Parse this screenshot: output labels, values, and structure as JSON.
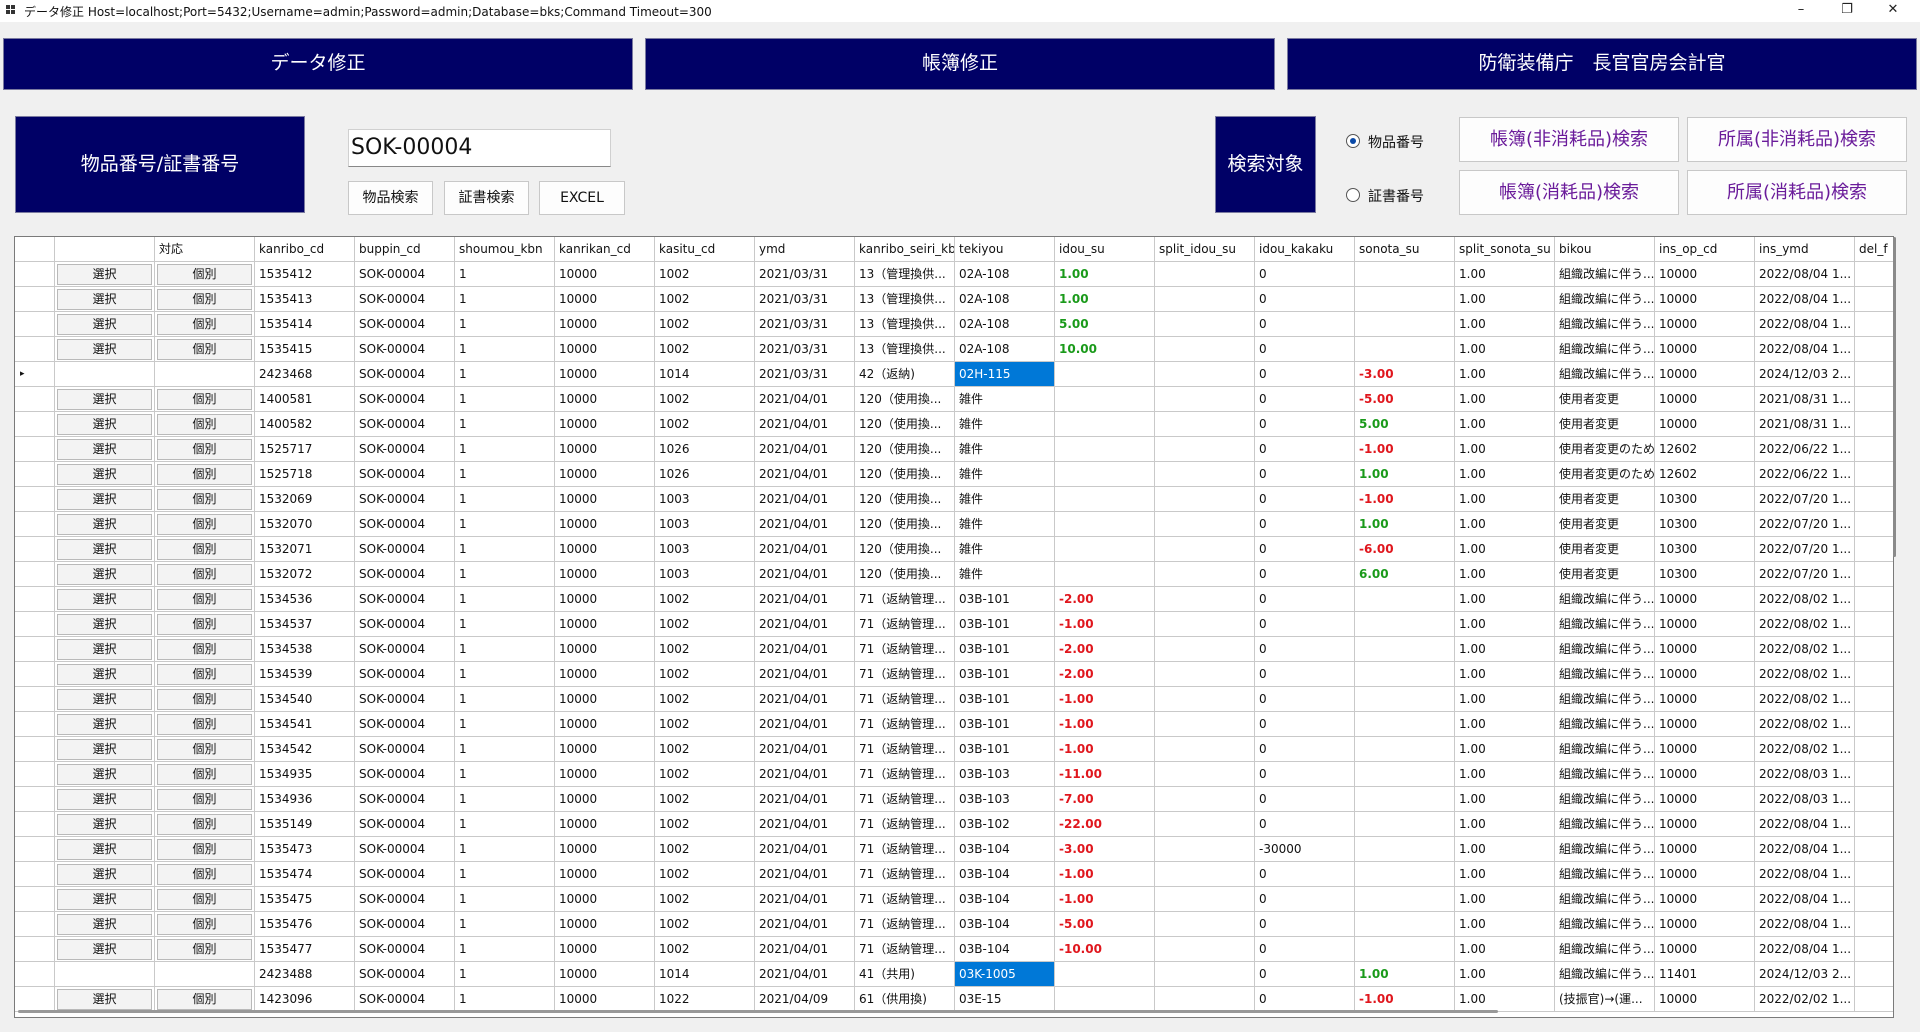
{
  "window": {
    "title": "データ修正 Host=localhost;Port=5432;Username=admin;Password=admin;Database=bks;Command Timeout=300",
    "minimize": "–",
    "maximize": "❐",
    "close": "✕"
  },
  "nav": {
    "data_edit": "データ修正",
    "ledger_edit": "帳簿修正",
    "org": "防衛装備庁　長官官房会計官"
  },
  "search": {
    "label": "物品番号/証書番号",
    "value": "SOK-00004",
    "btn_item": "物品検索",
    "btn_cert": "証書検索",
    "btn_excel": "EXCEL",
    "target_label": "検索対象",
    "radio_item": "物品番号",
    "radio_cert": "証書番号",
    "radio_selected": "物品番号",
    "btn_ledger_nonconsumable": "帳簿(非消耗品)検索",
    "btn_belong_nonconsumable": "所属(非消耗品)検索",
    "btn_ledger_consumable": "帳簿(消耗品)検索",
    "btn_belong_consumable": "所属(消耗品)検索"
  },
  "grid": {
    "columns": [
      "",
      "",
      "対応",
      "kanribo_cd",
      "buppin_cd",
      "shoumou_kbn",
      "kanrikan_cd",
      "kasitu_cd",
      "ymd",
      "kanribo_seiri_kbn",
      "tekiyou",
      "idou_su",
      "split_idou_su",
      "idou_kakaku",
      "sonota_su",
      "split_sonota_su",
      "bikou",
      "ins_op_cd",
      "ins_ymd",
      "del_f"
    ],
    "rows": [
      {
        "marker": "",
        "sel": "選択",
        "taiou": "個別",
        "kanribo_cd": "1535412",
        "buppin_cd": "SOK-00004",
        "shoumou": "1",
        "kanrikan": "10000",
        "kasitu": "1002",
        "ymd": "2021/03/31",
        "seiri": "13（管理換供...",
        "tekiyou": "02A-108",
        "idou": "1.00",
        "split_idou": "",
        "kakaku": "0",
        "sonota": "",
        "split_sonota": "1.00",
        "bikou": "組織改編に伴う...",
        "ins_op": "10000",
        "ins_ymd": "2022/08/04 1..."
      },
      {
        "marker": "",
        "sel": "選択",
        "taiou": "個別",
        "kanribo_cd": "1535413",
        "buppin_cd": "SOK-00004",
        "shoumou": "1",
        "kanrikan": "10000",
        "kasitu": "1002",
        "ymd": "2021/03/31",
        "seiri": "13（管理換供...",
        "tekiyou": "02A-108",
        "idou": "1.00",
        "split_idou": "",
        "kakaku": "0",
        "sonota": "",
        "split_sonota": "1.00",
        "bikou": "組織改編に伴う...",
        "ins_op": "10000",
        "ins_ymd": "2022/08/04 1..."
      },
      {
        "marker": "",
        "sel": "選択",
        "taiou": "個別",
        "kanribo_cd": "1535414",
        "buppin_cd": "SOK-00004",
        "shoumou": "1",
        "kanrikan": "10000",
        "kasitu": "1002",
        "ymd": "2021/03/31",
        "seiri": "13（管理換供...",
        "tekiyou": "02A-108",
        "idou": "5.00",
        "split_idou": "",
        "kakaku": "0",
        "sonota": "",
        "split_sonota": "1.00",
        "bikou": "組織改編に伴う...",
        "ins_op": "10000",
        "ins_ymd": "2022/08/04 1..."
      },
      {
        "marker": "",
        "sel": "選択",
        "taiou": "個別",
        "kanribo_cd": "1535415",
        "buppin_cd": "SOK-00004",
        "shoumou": "1",
        "kanrikan": "10000",
        "kasitu": "1002",
        "ymd": "2021/03/31",
        "seiri": "13（管理換供...",
        "tekiyou": "02A-108",
        "idou": "10.00",
        "split_idou": "",
        "kakaku": "0",
        "sonota": "",
        "split_sonota": "1.00",
        "bikou": "組織改編に伴う...",
        "ins_op": "10000",
        "ins_ymd": "2022/08/04 1..."
      },
      {
        "marker": "▸",
        "sel": "",
        "taiou": "",
        "kanribo_cd": "2423468",
        "buppin_cd": "SOK-00004",
        "shoumou": "1",
        "kanrikan": "10000",
        "kasitu": "1014",
        "ymd": "2021/03/31",
        "seiri": "42（返納)",
        "tekiyou": "02H-115",
        "tekiyou_selected": true,
        "idou": "",
        "split_idou": "",
        "kakaku": "0",
        "sonota": "-3.00",
        "split_sonota": "1.00",
        "bikou": "組織改編に伴う...",
        "ins_op": "10000",
        "ins_ymd": "2024/12/03 2..."
      },
      {
        "marker": "",
        "sel": "選択",
        "taiou": "個別",
        "kanribo_cd": "1400581",
        "buppin_cd": "SOK-00004",
        "shoumou": "1",
        "kanrikan": "10000",
        "kasitu": "1002",
        "ymd": "2021/04/01",
        "seiri": "120（使用換...",
        "tekiyou": "雑件",
        "idou": "",
        "split_idou": "",
        "kakaku": "0",
        "sonota": "-5.00",
        "split_sonota": "1.00",
        "bikou": "使用者変更",
        "ins_op": "10000",
        "ins_ymd": "2021/08/31 1..."
      },
      {
        "marker": "",
        "sel": "選択",
        "taiou": "個別",
        "kanribo_cd": "1400582",
        "buppin_cd": "SOK-00004",
        "shoumou": "1",
        "kanrikan": "10000",
        "kasitu": "1002",
        "ymd": "2021/04/01",
        "seiri": "120（使用換...",
        "tekiyou": "雑件",
        "idou": "",
        "split_idou": "",
        "kakaku": "0",
        "sonota": "5.00",
        "split_sonota": "1.00",
        "bikou": "使用者変更",
        "ins_op": "10000",
        "ins_ymd": "2021/08/31 1..."
      },
      {
        "marker": "",
        "sel": "選択",
        "taiou": "個別",
        "kanribo_cd": "1525717",
        "buppin_cd": "SOK-00004",
        "shoumou": "1",
        "kanrikan": "10000",
        "kasitu": "1026",
        "ymd": "2021/04/01",
        "seiri": "120（使用換...",
        "tekiyou": "雑件",
        "idou": "",
        "split_idou": "",
        "kakaku": "0",
        "sonota": "-1.00",
        "split_sonota": "1.00",
        "bikou": "使用者変更のため",
        "ins_op": "12602",
        "ins_ymd": "2022/06/22 1..."
      },
      {
        "marker": "",
        "sel": "選択",
        "taiou": "個別",
        "kanribo_cd": "1525718",
        "buppin_cd": "SOK-00004",
        "shoumou": "1",
        "kanrikan": "10000",
        "kasitu": "1026",
        "ymd": "2021/04/01",
        "seiri": "120（使用換...",
        "tekiyou": "雑件",
        "idou": "",
        "split_idou": "",
        "kakaku": "0",
        "sonota": "1.00",
        "split_sonota": "1.00",
        "bikou": "使用者変更のため",
        "ins_op": "12602",
        "ins_ymd": "2022/06/22 1..."
      },
      {
        "marker": "",
        "sel": "選択",
        "taiou": "個別",
        "kanribo_cd": "1532069",
        "buppin_cd": "SOK-00004",
        "shoumou": "1",
        "kanrikan": "10000",
        "kasitu": "1003",
        "ymd": "2021/04/01",
        "seiri": "120（使用換...",
        "tekiyou": "雑件",
        "idou": "",
        "split_idou": "",
        "kakaku": "0",
        "sonota": "-1.00",
        "split_sonota": "1.00",
        "bikou": "使用者変更",
        "ins_op": "10300",
        "ins_ymd": "2022/07/20 1..."
      },
      {
        "marker": "",
        "sel": "選択",
        "taiou": "個別",
        "kanribo_cd": "1532070",
        "buppin_cd": "SOK-00004",
        "shoumou": "1",
        "kanrikan": "10000",
        "kasitu": "1003",
        "ymd": "2021/04/01",
        "seiri": "120（使用換...",
        "tekiyou": "雑件",
        "idou": "",
        "split_idou": "",
        "kakaku": "0",
        "sonota": "1.00",
        "split_sonota": "1.00",
        "bikou": "使用者変更",
        "ins_op": "10300",
        "ins_ymd": "2022/07/20 1..."
      },
      {
        "marker": "",
        "sel": "選択",
        "taiou": "個別",
        "kanribo_cd": "1532071",
        "buppin_cd": "SOK-00004",
        "shoumou": "1",
        "kanrikan": "10000",
        "kasitu": "1003",
        "ymd": "2021/04/01",
        "seiri": "120（使用換...",
        "tekiyou": "雑件",
        "idou": "",
        "split_idou": "",
        "kakaku": "0",
        "sonota": "-6.00",
        "split_sonota": "1.00",
        "bikou": "使用者変更",
        "ins_op": "10300",
        "ins_ymd": "2022/07/20 1..."
      },
      {
        "marker": "",
        "sel": "選択",
        "taiou": "個別",
        "kanribo_cd": "1532072",
        "buppin_cd": "SOK-00004",
        "shoumou": "1",
        "kanrikan": "10000",
        "kasitu": "1003",
        "ymd": "2021/04/01",
        "seiri": "120（使用換...",
        "tekiyou": "雑件",
        "idou": "",
        "split_idou": "",
        "kakaku": "0",
        "sonota": "6.00",
        "split_sonota": "1.00",
        "bikou": "使用者変更",
        "ins_op": "10300",
        "ins_ymd": "2022/07/20 1..."
      },
      {
        "marker": "",
        "sel": "選択",
        "taiou": "個別",
        "kanribo_cd": "1534536",
        "buppin_cd": "SOK-00004",
        "shoumou": "1",
        "kanrikan": "10000",
        "kasitu": "1002",
        "ymd": "2021/04/01",
        "seiri": "71（返納管理...",
        "tekiyou": "03B-101",
        "idou": "-2.00",
        "split_idou": "",
        "kakaku": "0",
        "sonota": "",
        "split_sonota": "1.00",
        "bikou": "組織改編に伴う...",
        "ins_op": "10000",
        "ins_ymd": "2022/08/02 1..."
      },
      {
        "marker": "",
        "sel": "選択",
        "taiou": "個別",
        "kanribo_cd": "1534537",
        "buppin_cd": "SOK-00004",
        "shoumou": "1",
        "kanrikan": "10000",
        "kasitu": "1002",
        "ymd": "2021/04/01",
        "seiri": "71（返納管理...",
        "tekiyou": "03B-101",
        "idou": "-1.00",
        "split_idou": "",
        "kakaku": "0",
        "sonota": "",
        "split_sonota": "1.00",
        "bikou": "組織改編に伴う...",
        "ins_op": "10000",
        "ins_ymd": "2022/08/02 1..."
      },
      {
        "marker": "",
        "sel": "選択",
        "taiou": "個別",
        "kanribo_cd": "1534538",
        "buppin_cd": "SOK-00004",
        "shoumou": "1",
        "kanrikan": "10000",
        "kasitu": "1002",
        "ymd": "2021/04/01",
        "seiri": "71（返納管理...",
        "tekiyou": "03B-101",
        "idou": "-2.00",
        "split_idou": "",
        "kakaku": "0",
        "sonota": "",
        "split_sonota": "1.00",
        "bikou": "組織改編に伴う...",
        "ins_op": "10000",
        "ins_ymd": "2022/08/02 1..."
      },
      {
        "marker": "",
        "sel": "選択",
        "taiou": "個別",
        "kanribo_cd": "1534539",
        "buppin_cd": "SOK-00004",
        "shoumou": "1",
        "kanrikan": "10000",
        "kasitu": "1002",
        "ymd": "2021/04/01",
        "seiri": "71（返納管理...",
        "tekiyou": "03B-101",
        "idou": "-2.00",
        "split_idou": "",
        "kakaku": "0",
        "sonota": "",
        "split_sonota": "1.00",
        "bikou": "組織改編に伴う...",
        "ins_op": "10000",
        "ins_ymd": "2022/08/02 1..."
      },
      {
        "marker": "",
        "sel": "選択",
        "taiou": "個別",
        "kanribo_cd": "1534540",
        "buppin_cd": "SOK-00004",
        "shoumou": "1",
        "kanrikan": "10000",
        "kasitu": "1002",
        "ymd": "2021/04/01",
        "seiri": "71（返納管理...",
        "tekiyou": "03B-101",
        "idou": "-1.00",
        "split_idou": "",
        "kakaku": "0",
        "sonota": "",
        "split_sonota": "1.00",
        "bikou": "組織改編に伴う...",
        "ins_op": "10000",
        "ins_ymd": "2022/08/02 1..."
      },
      {
        "marker": "",
        "sel": "選択",
        "taiou": "個別",
        "kanribo_cd": "1534541",
        "buppin_cd": "SOK-00004",
        "shoumou": "1",
        "kanrikan": "10000",
        "kasitu": "1002",
        "ymd": "2021/04/01",
        "seiri": "71（返納管理...",
        "tekiyou": "03B-101",
        "idou": "-1.00",
        "split_idou": "",
        "kakaku": "0",
        "sonota": "",
        "split_sonota": "1.00",
        "bikou": "組織改編に伴う...",
        "ins_op": "10000",
        "ins_ymd": "2022/08/02 1..."
      },
      {
        "marker": "",
        "sel": "選択",
        "taiou": "個別",
        "kanribo_cd": "1534542",
        "buppin_cd": "SOK-00004",
        "shoumou": "1",
        "kanrikan": "10000",
        "kasitu": "1002",
        "ymd": "2021/04/01",
        "seiri": "71（返納管理...",
        "tekiyou": "03B-101",
        "idou": "-1.00",
        "split_idou": "",
        "kakaku": "0",
        "sonota": "",
        "split_sonota": "1.00",
        "bikou": "組織改編に伴う...",
        "ins_op": "10000",
        "ins_ymd": "2022/08/02 1..."
      },
      {
        "marker": "",
        "sel": "選択",
        "taiou": "個別",
        "kanribo_cd": "1534935",
        "buppin_cd": "SOK-00004",
        "shoumou": "1",
        "kanrikan": "10000",
        "kasitu": "1002",
        "ymd": "2021/04/01",
        "seiri": "71（返納管理...",
        "tekiyou": "03B-103",
        "idou": "-11.00",
        "split_idou": "",
        "kakaku": "0",
        "sonota": "",
        "split_sonota": "1.00",
        "bikou": "組織改編に伴う...",
        "ins_op": "10000",
        "ins_ymd": "2022/08/03 1..."
      },
      {
        "marker": "",
        "sel": "選択",
        "taiou": "個別",
        "kanribo_cd": "1534936",
        "buppin_cd": "SOK-00004",
        "shoumou": "1",
        "kanrikan": "10000",
        "kasitu": "1002",
        "ymd": "2021/04/01",
        "seiri": "71（返納管理...",
        "tekiyou": "03B-103",
        "idou": "-7.00",
        "split_idou": "",
        "kakaku": "0",
        "sonota": "",
        "split_sonota": "1.00",
        "bikou": "組織改編に伴う...",
        "ins_op": "10000",
        "ins_ymd": "2022/08/03 1..."
      },
      {
        "marker": "",
        "sel": "選択",
        "taiou": "個別",
        "kanribo_cd": "1535149",
        "buppin_cd": "SOK-00004",
        "shoumou": "1",
        "kanrikan": "10000",
        "kasitu": "1002",
        "ymd": "2021/04/01",
        "seiri": "71（返納管理...",
        "tekiyou": "03B-102",
        "idou": "-22.00",
        "split_idou": "",
        "kakaku": "0",
        "sonota": "",
        "split_sonota": "1.00",
        "bikou": "組織改編に伴う...",
        "ins_op": "10000",
        "ins_ymd": "2022/08/04 1..."
      },
      {
        "marker": "",
        "sel": "選択",
        "taiou": "個別",
        "kanribo_cd": "1535473",
        "buppin_cd": "SOK-00004",
        "shoumou": "1",
        "kanrikan": "10000",
        "kasitu": "1002",
        "ymd": "2021/04/01",
        "seiri": "71（返納管理...",
        "tekiyou": "03B-104",
        "idou": "-3.00",
        "split_idou": "",
        "kakaku": "-30000",
        "sonota": "",
        "split_sonota": "1.00",
        "bikou": "組織改編に伴う...",
        "ins_op": "10000",
        "ins_ymd": "2022/08/04 1..."
      },
      {
        "marker": "",
        "sel": "選択",
        "taiou": "個別",
        "kanribo_cd": "1535474",
        "buppin_cd": "SOK-00004",
        "shoumou": "1",
        "kanrikan": "10000",
        "kasitu": "1002",
        "ymd": "2021/04/01",
        "seiri": "71（返納管理...",
        "tekiyou": "03B-104",
        "idou": "-1.00",
        "split_idou": "",
        "kakaku": "0",
        "sonota": "",
        "split_sonota": "1.00",
        "bikou": "組織改編に伴う...",
        "ins_op": "10000",
        "ins_ymd": "2022/08/04 1..."
      },
      {
        "marker": "",
        "sel": "選択",
        "taiou": "個別",
        "kanribo_cd": "1535475",
        "buppin_cd": "SOK-00004",
        "shoumou": "1",
        "kanrikan": "10000",
        "kasitu": "1002",
        "ymd": "2021/04/01",
        "seiri": "71（返納管理...",
        "tekiyou": "03B-104",
        "idou": "-1.00",
        "split_idou": "",
        "kakaku": "0",
        "sonota": "",
        "split_sonota": "1.00",
        "bikou": "組織改編に伴う...",
        "ins_op": "10000",
        "ins_ymd": "2022/08/04 1..."
      },
      {
        "marker": "",
        "sel": "選択",
        "taiou": "個別",
        "kanribo_cd": "1535476",
        "buppin_cd": "SOK-00004",
        "shoumou": "1",
        "kanrikan": "10000",
        "kasitu": "1002",
        "ymd": "2021/04/01",
        "seiri": "71（返納管理...",
        "tekiyou": "03B-104",
        "idou": "-5.00",
        "split_idou": "",
        "kakaku": "0",
        "sonota": "",
        "split_sonota": "1.00",
        "bikou": "組織改編に伴う...",
        "ins_op": "10000",
        "ins_ymd": "2022/08/04 1..."
      },
      {
        "marker": "",
        "sel": "選択",
        "taiou": "個別",
        "kanribo_cd": "1535477",
        "buppin_cd": "SOK-00004",
        "shoumou": "1",
        "kanrikan": "10000",
        "kasitu": "1002",
        "ymd": "2021/04/01",
        "seiri": "71（返納管理...",
        "tekiyou": "03B-104",
        "idou": "-10.00",
        "split_idou": "",
        "kakaku": "0",
        "sonota": "",
        "split_sonota": "1.00",
        "bikou": "組織改編に伴う...",
        "ins_op": "10000",
        "ins_ymd": "2022/08/04 1..."
      },
      {
        "marker": "",
        "sel": "",
        "taiou": "",
        "kanribo_cd": "2423488",
        "buppin_cd": "SOK-00004",
        "shoumou": "1",
        "kanrikan": "10000",
        "kasitu": "1014",
        "ymd": "2021/04/01",
        "seiri": "41（共用)",
        "tekiyou": "03K-1005",
        "tekiyou_selected": true,
        "idou": "",
        "split_idou": "",
        "kakaku": "0",
        "sonota": "1.00",
        "split_sonota": "1.00",
        "bikou": "組織改編に伴う...",
        "ins_op": "11401",
        "ins_ymd": "2024/12/03 2..."
      },
      {
        "marker": "",
        "sel": "選択",
        "taiou": "個別",
        "kanribo_cd": "1423096",
        "buppin_cd": "SOK-00004",
        "shoumou": "1",
        "kanrikan": "10000",
        "kasitu": "1022",
        "ymd": "2021/04/09",
        "seiri": "61（供用換)",
        "tekiyou": "03E-15",
        "idou": "",
        "split_idou": "",
        "kakaku": "0",
        "sonota": "-1.00",
        "split_sonota": "1.00",
        "bikou": "(技振官)→(運...",
        "ins_op": "10000",
        "ins_ymd": "2022/02/02 1..."
      }
    ]
  }
}
